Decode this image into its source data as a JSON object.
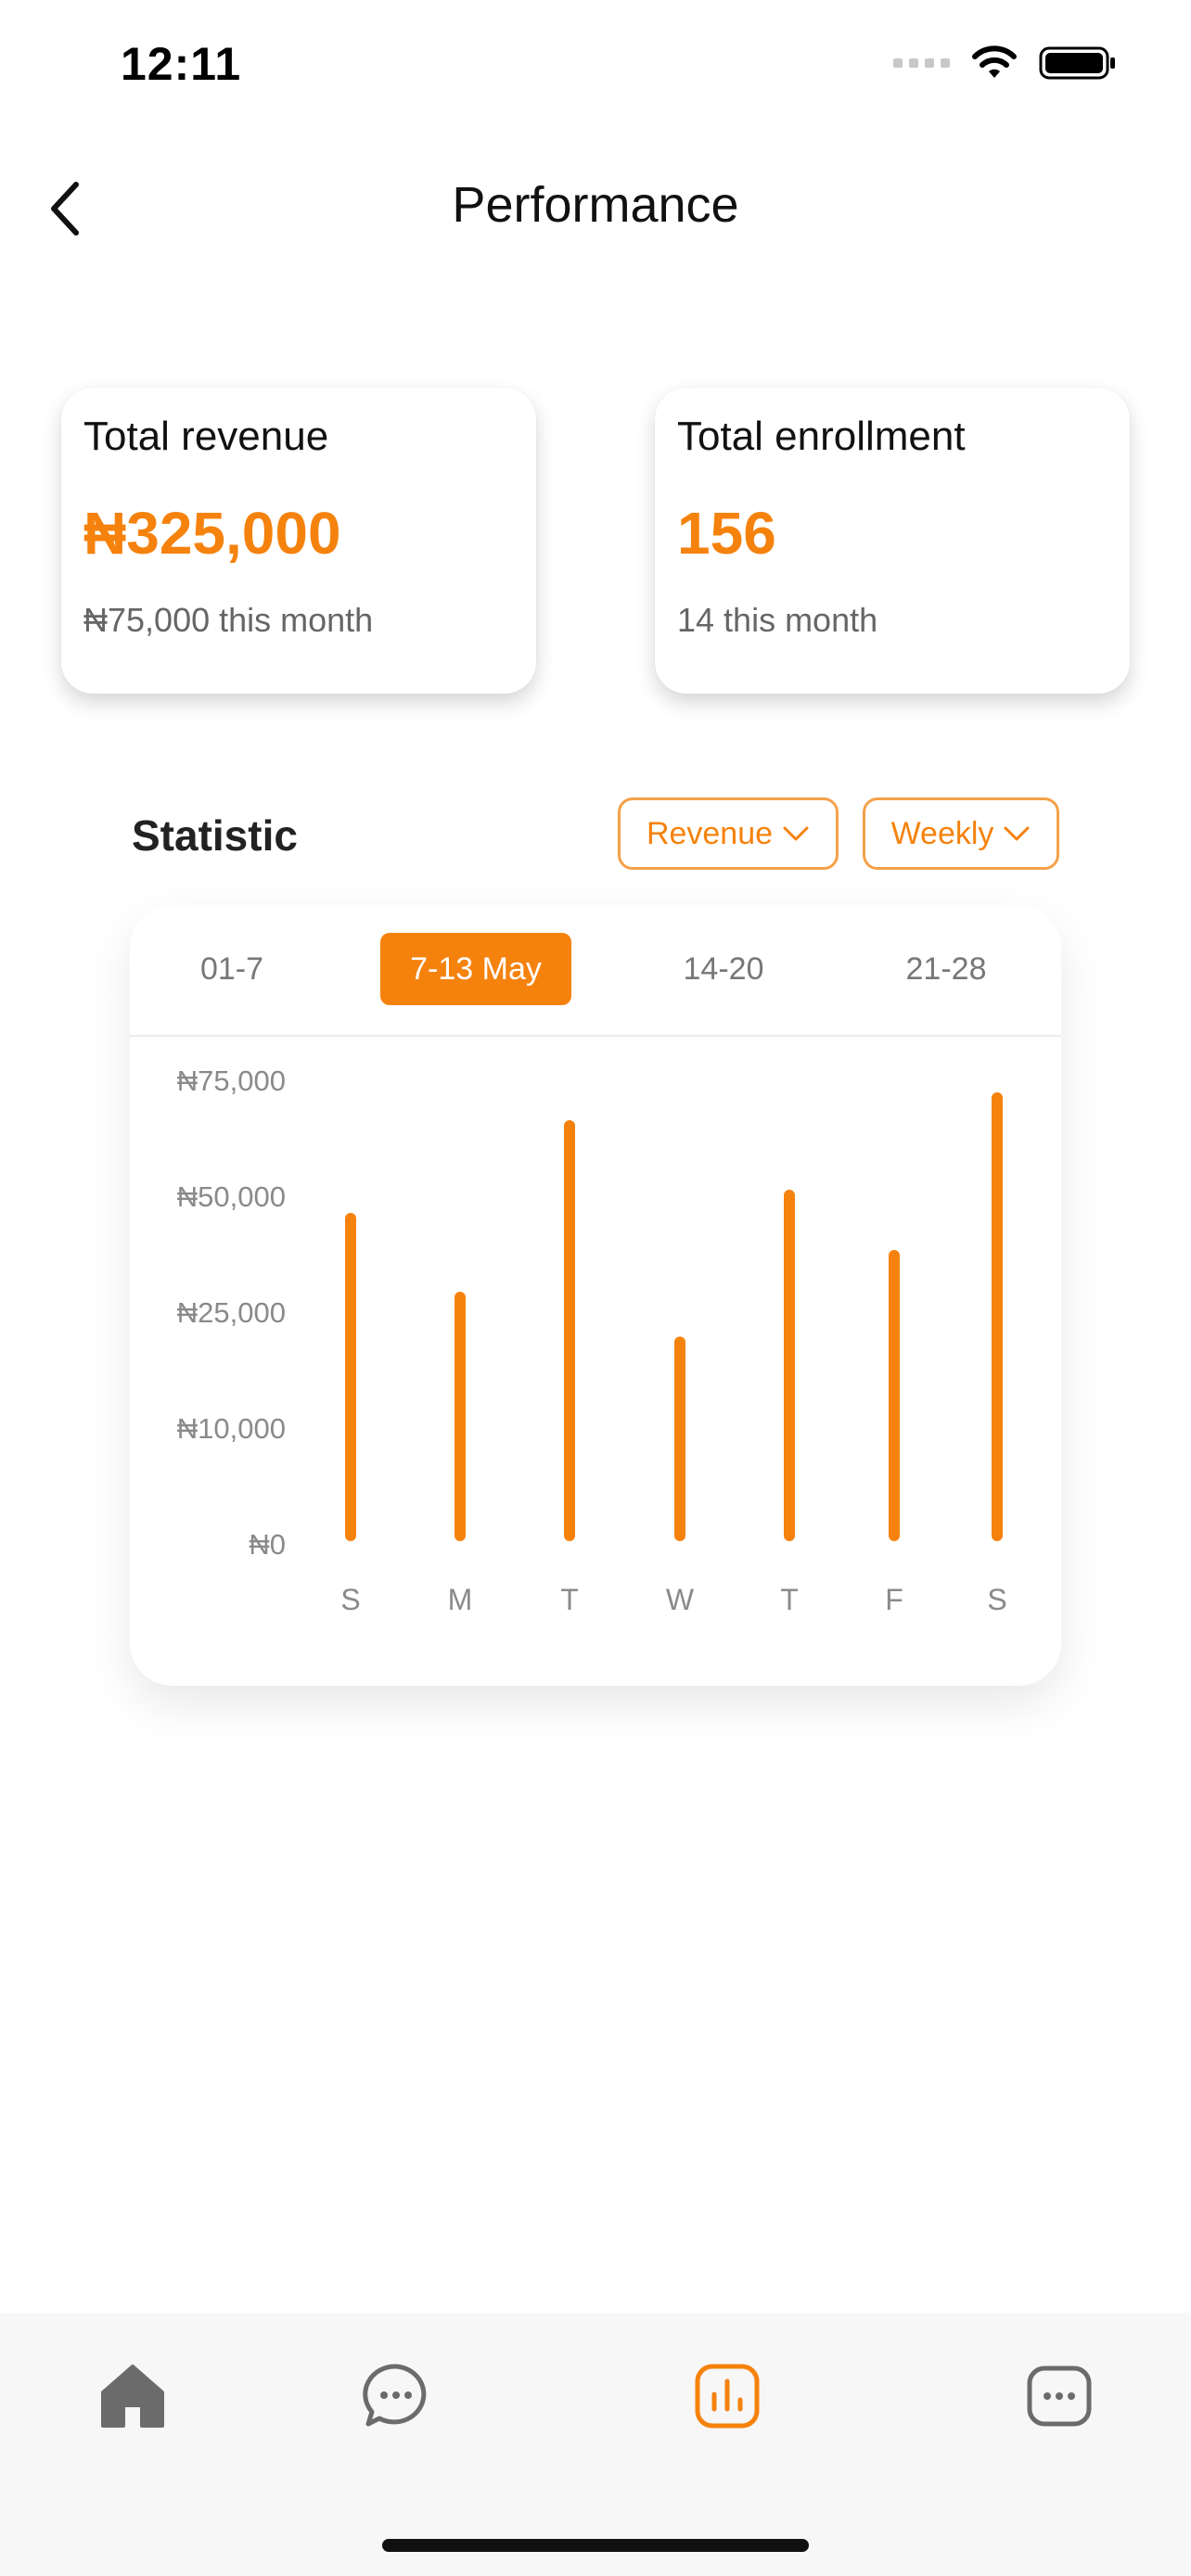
{
  "status_bar": {
    "time": "12:11"
  },
  "header": {
    "title": "Performance"
  },
  "cards": {
    "revenue": {
      "title": "Total revenue",
      "value": "₦325,000",
      "sub": "₦75,000 this month"
    },
    "enrollment": {
      "title": "Total enrollment",
      "value": "156",
      "sub": "14 this month"
    }
  },
  "statistic": {
    "title": "Statistic",
    "metric_filter": "Revenue",
    "period_filter": "Weekly",
    "week_tabs": [
      "01-7",
      "7-13 May",
      "14-20",
      "21-28"
    ],
    "active_week": "7-13 May"
  },
  "colors": {
    "accent": "#f5820d",
    "accent_border": "#f5a04a"
  },
  "chart_data": {
    "type": "bar",
    "categories": [
      "S",
      "M",
      "T",
      "W",
      "T",
      "F",
      "S"
    ],
    "values": [
      45000,
      28000,
      65000,
      21000,
      50000,
      37000,
      71000
    ],
    "y_ticks": [
      0,
      10000,
      25000,
      50000,
      75000
    ],
    "y_tick_labels": [
      "₦0",
      "₦10,000",
      "₦25,000",
      "₦50,000",
      "₦75,000"
    ],
    "ylim": [
      0,
      75000
    ],
    "grid": false,
    "title": "",
    "xlabel": "",
    "ylabel": ""
  },
  "bottom_nav": [
    {
      "icon": "home-icon"
    },
    {
      "icon": "chat-icon"
    },
    {
      "icon": "stats-icon",
      "active": true
    },
    {
      "icon": "messages-icon"
    }
  ]
}
